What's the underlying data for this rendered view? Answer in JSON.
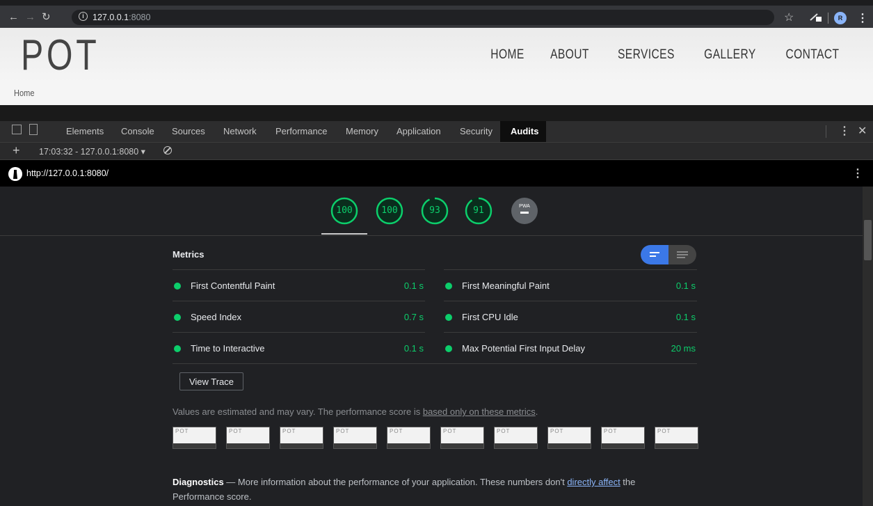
{
  "browser": {
    "url_host": "127.0.0.1",
    "url_port": ":8080",
    "profile_initial": "R"
  },
  "site": {
    "logo": "POT",
    "nav": [
      "HOME",
      "ABOUT",
      "SERVICES",
      "GALLERY",
      "CONTACT"
    ],
    "breadcrumb": "Home"
  },
  "devtools": {
    "tabs": [
      "Elements",
      "Console",
      "Sources",
      "Network",
      "Performance",
      "Memory",
      "Application",
      "Security",
      "Audits"
    ],
    "active_tab": "Audits",
    "report_select": "17:03:32 - 127.0.0.1:8080 ▾"
  },
  "audit": {
    "url": "http://127.0.0.1:8080/",
    "scores": [
      "100",
      "100",
      "93",
      "91"
    ],
    "score_fractions": [
      1.0,
      1.0,
      0.93,
      0.91
    ],
    "pwa_label": "PWA",
    "metrics_title": "Metrics",
    "metrics": [
      {
        "label": "First Contentful Paint",
        "value": "0.1 s"
      },
      {
        "label": "First Meaningful Paint",
        "value": "0.1 s"
      },
      {
        "label": "Speed Index",
        "value": "0.7 s"
      },
      {
        "label": "First CPU Idle",
        "value": "0.1 s"
      },
      {
        "label": "Time to Interactive",
        "value": "0.1 s"
      },
      {
        "label": "Max Potential First Input Delay",
        "value": "20 ms"
      }
    ],
    "view_trace": "View Trace",
    "disclaimer_text": "Values are estimated and may vary. The performance score is ",
    "disclaimer_link": "based only on these metrics",
    "disclaimer_end": ".",
    "thumbnail_label": "POT",
    "diagnostics_title": "Diagnostics",
    "diagnostics_dash": " — ",
    "diagnostics_text": "More information about the performance of your application. These numbers don't ",
    "diagnostics_link": "directly affect",
    "diagnostics_end": " the Performance score."
  },
  "colors": {
    "pass": "#0cce6b",
    "accent": "#3b78e7"
  }
}
